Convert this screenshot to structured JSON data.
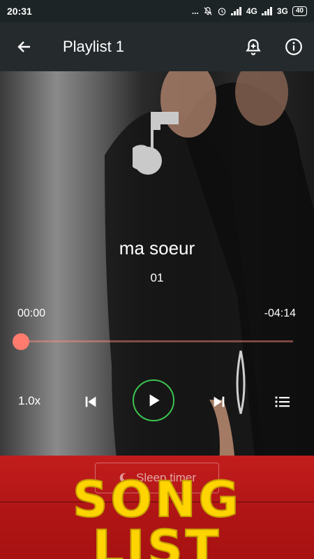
{
  "status_bar": {
    "time": "20:31",
    "dots": "...",
    "network_4g": "4G",
    "network_3g": "3G",
    "battery": "40"
  },
  "app_bar": {
    "title": "Playlist 1",
    "icons": [
      "back-arrow-icon",
      "alarm-add-icon",
      "info-icon"
    ]
  },
  "player": {
    "song_title": "ma soeur",
    "song_number": "01",
    "elapsed": "00:00",
    "remaining": "-04:14",
    "progress": 0,
    "speed": "1.0x",
    "accent_color": "#ff7b6e",
    "play_ring_color": "#3cc350"
  },
  "sleep_timer": {
    "label": "Sleep timer"
  },
  "banner": {
    "text": "SONG LIST",
    "text_color": "#ffd400",
    "bg_color": "#b81818"
  }
}
